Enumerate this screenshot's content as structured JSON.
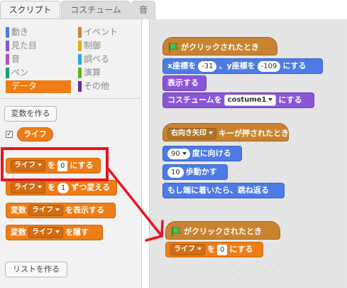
{
  "tabs": [
    "スクリプト",
    "コスチューム",
    "音"
  ],
  "categories_left": [
    {
      "label": "動き",
      "color": "#4c7be6"
    },
    {
      "label": "見た目",
      "color": "#8a55d7"
    },
    {
      "label": "音",
      "color": "#b84fb5"
    },
    {
      "label": "ペン",
      "color": "#0fa36b"
    },
    {
      "label": "データ",
      "color": "#ee7d16"
    }
  ],
  "categories_right": [
    {
      "label": "イベント",
      "color": "#c88330"
    },
    {
      "label": "制御",
      "color": "#e1a91a"
    },
    {
      "label": "調べる",
      "color": "#2ca5e2"
    },
    {
      "label": "演算",
      "color": "#5cb712"
    },
    {
      "label": "その他",
      "color": "#632d99"
    }
  ],
  "palette": {
    "make_variable": "変数を作る",
    "variable_name": "ライフ",
    "set_block": {
      "var": "ライフ",
      "to": "を",
      "value": "0",
      "suffix": "にする"
    },
    "change_block": {
      "var": "ライフ",
      "to": "を",
      "value": "1",
      "suffix": "ずつ変える"
    },
    "show_block": {
      "prefix": "変数",
      "var": "ライフ",
      "suffix": "を表示する"
    },
    "hide_block": {
      "prefix": "変数",
      "var": "ライフ",
      "suffix": "を隠す"
    },
    "make_list": "リストを作る"
  },
  "script1": {
    "hat": "がクリックされたとき",
    "goto": {
      "a": "x座標を",
      "x": "-31",
      "b": "、y座標を",
      "y": "-109",
      "c": "にする"
    },
    "show": "表示する",
    "costume": {
      "a": "コスチュームを",
      "name": "costume1",
      "b": "にする"
    }
  },
  "script2": {
    "hat": {
      "key": "右向き矢印",
      "text": "キーが押されたとき"
    },
    "point": {
      "value": "90",
      "text": "度に向ける"
    },
    "move": {
      "value": "10",
      "text": "歩動かす"
    },
    "bounce": "もし端に着いたら、跳ね返る"
  },
  "script3": {
    "hat": "がクリックされたとき",
    "set": {
      "var": "ライフ",
      "to": "を",
      "value": "0",
      "suffix": "にする"
    }
  },
  "colors": {
    "data": "#ee7d16",
    "motion": "#4c7be6",
    "looks": "#8a55d7",
    "events": "#c88330",
    "highlight": "#e8141e"
  }
}
